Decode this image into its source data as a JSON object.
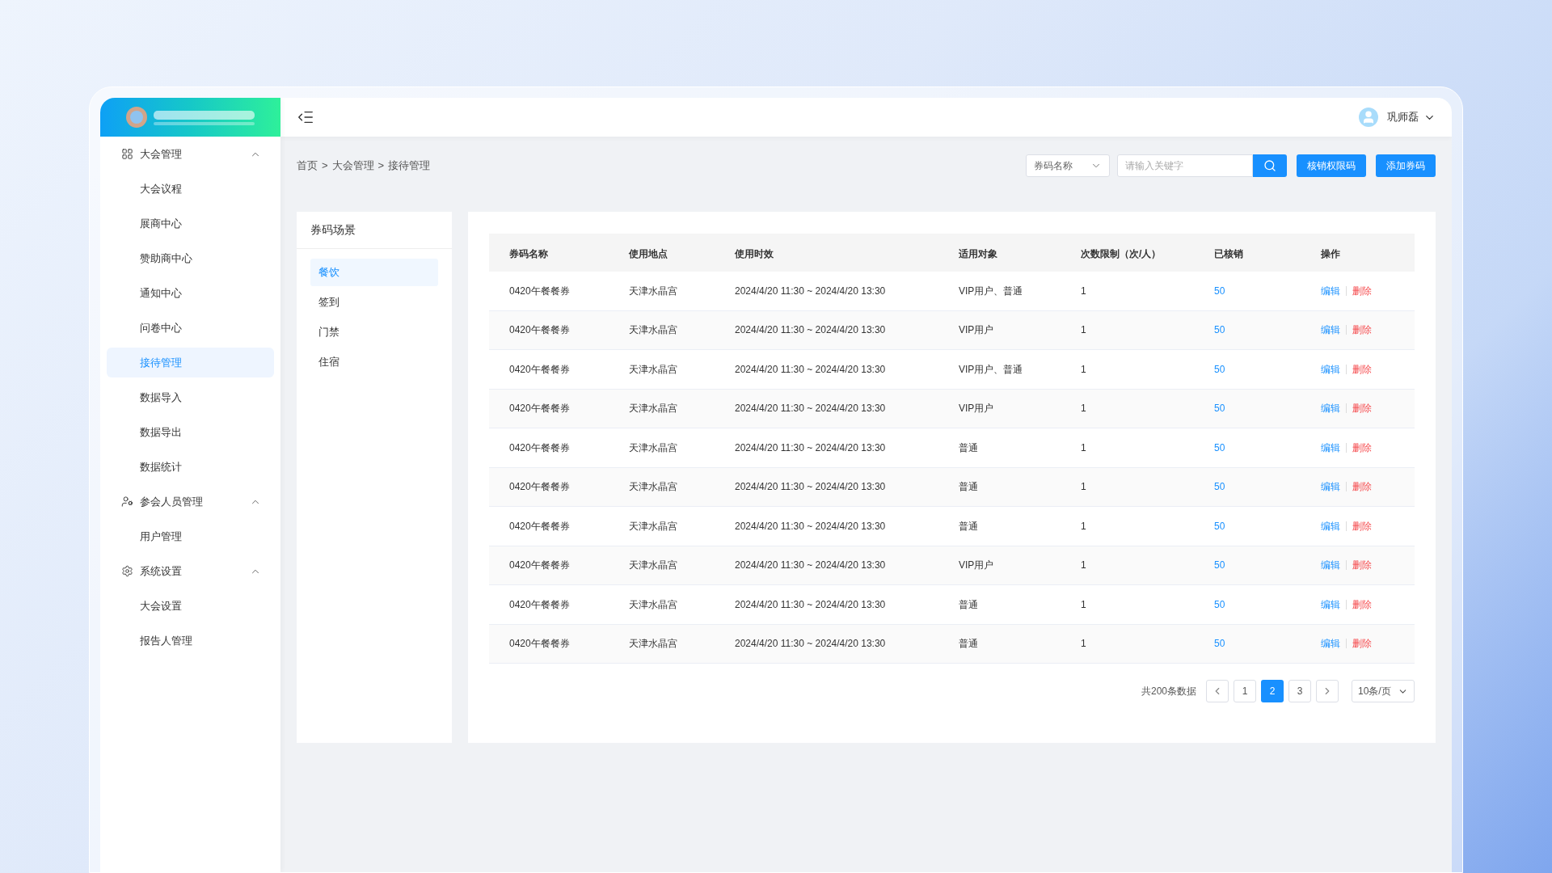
{
  "header": {
    "user": "巩师磊"
  },
  "sidebar": {
    "groups": [
      {
        "label": "大会管理",
        "expanded": true,
        "items": [
          {
            "label": "大会议程",
            "selected": false
          },
          {
            "label": "展商中心",
            "selected": false
          },
          {
            "label": "赞助商中心",
            "selected": false
          },
          {
            "label": "通知中心",
            "selected": false
          },
          {
            "label": "问卷中心",
            "selected": false
          },
          {
            "label": "接待管理",
            "selected": true
          },
          {
            "label": "数据导入",
            "selected": false
          },
          {
            "label": "数据导出",
            "selected": false
          },
          {
            "label": "数据统计",
            "selected": false
          }
        ]
      },
      {
        "label": "参会人员管理",
        "expanded": true,
        "items": [
          {
            "label": "用户管理",
            "selected": false
          }
        ]
      },
      {
        "label": "系统设置",
        "expanded": true,
        "items": [
          {
            "label": "大会设置",
            "selected": false
          },
          {
            "label": "报告人管理",
            "selected": false
          }
        ]
      }
    ]
  },
  "breadcrumb": [
    "首页",
    "大会管理",
    "接待管理"
  ],
  "breadcrumb_separator": ">",
  "toolbar": {
    "filter_select": "券码名称",
    "search": {
      "placeholder": "请输入关键字"
    },
    "buttons": [
      "核销权限码",
      "添加券码"
    ]
  },
  "scenes": {
    "title": "券码场景",
    "items": [
      {
        "label": "餐饮",
        "selected": true
      },
      {
        "label": "签到",
        "selected": false
      },
      {
        "label": "门禁",
        "selected": false
      },
      {
        "label": "住宿",
        "selected": false
      }
    ]
  },
  "table": {
    "columns": [
      "券码名称",
      "使用地点",
      "使用时效",
      "适用对象",
      "次数限制（次/人）",
      "已核销",
      "操作"
    ],
    "rows": [
      {
        "name": "0420午餐餐券",
        "place": "天津水晶宫",
        "period": "2024/4/20 11:30 ~ 2024/4/20 13:30",
        "target": "VIP用户、普通",
        "limit": "1",
        "used": "50",
        "actions": [
          "编辑",
          "删除"
        ]
      },
      {
        "name": "0420午餐餐券",
        "place": "天津水晶宫",
        "period": "2024/4/20 11:30 ~ 2024/4/20 13:30",
        "target": "VIP用户",
        "limit": "1",
        "used": "50",
        "actions": [
          "编辑",
          "删除"
        ]
      },
      {
        "name": "0420午餐餐券",
        "place": "天津水晶宫",
        "period": "2024/4/20 11:30 ~ 2024/4/20 13:30",
        "target": "VIP用户、普通",
        "limit": "1",
        "used": "50",
        "actions": [
          "编辑",
          "删除"
        ]
      },
      {
        "name": "0420午餐餐券",
        "place": "天津水晶宫",
        "period": "2024/4/20 11:30 ~ 2024/4/20 13:30",
        "target": "VIP用户",
        "limit": "1",
        "used": "50",
        "actions": [
          "编辑",
          "删除"
        ]
      },
      {
        "name": "0420午餐餐券",
        "place": "天津水晶宫",
        "period": "2024/4/20 11:30 ~ 2024/4/20 13:30",
        "target": "普通",
        "limit": "1",
        "used": "50",
        "actions": [
          "编辑",
          "删除"
        ]
      },
      {
        "name": "0420午餐餐券",
        "place": "天津水晶宫",
        "period": "2024/4/20 11:30 ~ 2024/4/20 13:30",
        "target": "普通",
        "limit": "1",
        "used": "50",
        "actions": [
          "编辑",
          "删除"
        ]
      },
      {
        "name": "0420午餐餐券",
        "place": "天津水晶宫",
        "period": "2024/4/20 11:30 ~ 2024/4/20 13:30",
        "target": "普通",
        "limit": "1",
        "used": "50",
        "actions": [
          "编辑",
          "删除"
        ]
      },
      {
        "name": "0420午餐餐券",
        "place": "天津水晶宫",
        "period": "2024/4/20 11:30 ~ 2024/4/20 13:30",
        "target": "VIP用户",
        "limit": "1",
        "used": "50",
        "actions": [
          "编辑",
          "删除"
        ]
      },
      {
        "name": "0420午餐餐券",
        "place": "天津水晶宫",
        "period": "2024/4/20 11:30 ~ 2024/4/20 13:30",
        "target": "普通",
        "limit": "1",
        "used": "50",
        "actions": [
          "编辑",
          "删除"
        ]
      },
      {
        "name": "0420午餐餐券",
        "place": "天津水晶宫",
        "period": "2024/4/20 11:30 ~ 2024/4/20 13:30",
        "target": "普通",
        "limit": "1",
        "used": "50",
        "actions": [
          "编辑",
          "删除"
        ]
      }
    ]
  },
  "pagination": {
    "total": "共200条数据",
    "pages": [
      {
        "label": "1",
        "selected": false
      },
      {
        "label": "2",
        "selected": true
      },
      {
        "label": "3",
        "selected": false
      }
    ],
    "page_size": "10条/页"
  }
}
